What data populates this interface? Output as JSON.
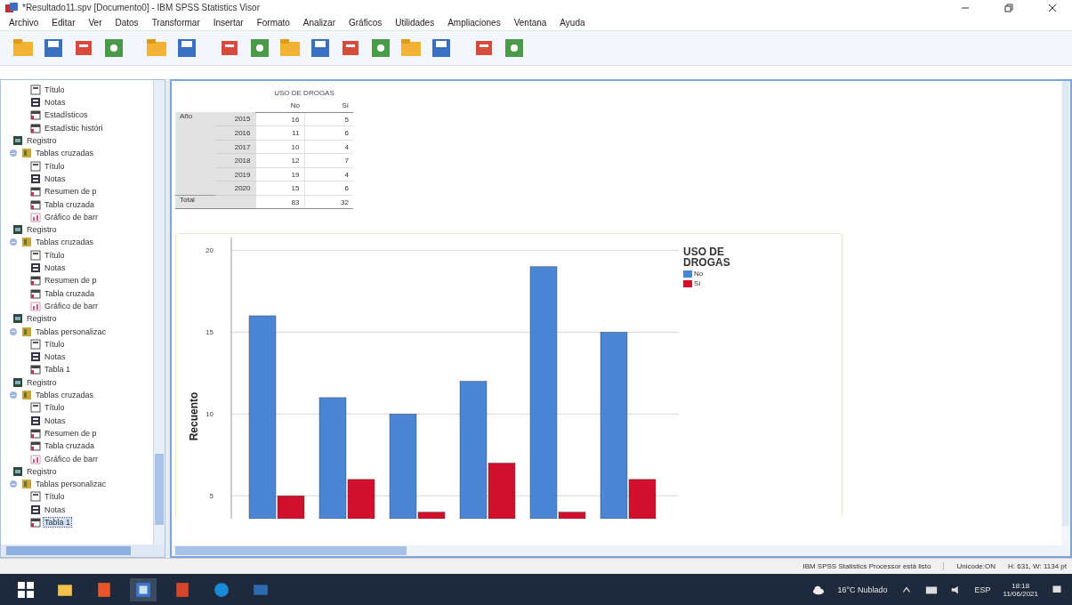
{
  "window": {
    "title": "*Resultado11.spv [Documento0] - IBM SPSS Statistics Visor"
  },
  "menu": [
    "Archivo",
    "Editar",
    "Ver",
    "Datos",
    "Transformar",
    "Insertar",
    "Formato",
    "Analizar",
    "Gráficos",
    "Utilidades",
    "Ampliaciones",
    "Ventana",
    "Ayuda"
  ],
  "outline": {
    "continued": [
      {
        "label": "Título",
        "kind": "title",
        "selected": false
      },
      {
        "label": "Notas",
        "kind": "notes",
        "selected": false
      },
      {
        "label": "Estadísticos",
        "kind": "table",
        "selected": false
      },
      {
        "label": "Estadístic históri",
        "kind": "table",
        "selected": false
      }
    ],
    "items": [
      {
        "label": "Registro",
        "kind": "log",
        "selected": false
      },
      {
        "label": "Tablas cruzadas",
        "kind": "folder",
        "expanded": true,
        "selected": false,
        "children": [
          {
            "label": "Título",
            "kind": "title",
            "selected": false
          },
          {
            "label": "Notas",
            "kind": "notes",
            "selected": false
          },
          {
            "label": "Resumen de p",
            "kind": "table",
            "selected": false
          },
          {
            "label": "Tabla cruzada",
            "kind": "table",
            "selected": false
          },
          {
            "label": "Gráfico de barr",
            "kind": "chart",
            "selected": false
          }
        ]
      },
      {
        "label": "Registro",
        "kind": "log",
        "selected": false
      },
      {
        "label": "Tablas cruzadas",
        "kind": "folder",
        "expanded": true,
        "selected": false,
        "children": [
          {
            "label": "Título",
            "kind": "title",
            "selected": false
          },
          {
            "label": "Notas",
            "kind": "notes",
            "selected": false
          },
          {
            "label": "Resumen de p",
            "kind": "table",
            "selected": false
          },
          {
            "label": "Tabla cruzada",
            "kind": "table",
            "selected": false
          },
          {
            "label": "Gráfico de barr",
            "kind": "chart",
            "selected": false
          }
        ]
      },
      {
        "label": "Registro",
        "kind": "log",
        "selected": false
      },
      {
        "label": "Tablas personalizac",
        "kind": "folder",
        "expanded": true,
        "selected": false,
        "children": [
          {
            "label": "Título",
            "kind": "title",
            "selected": false
          },
          {
            "label": "Notas",
            "kind": "notes",
            "selected": false
          },
          {
            "label": "Tabla 1",
            "kind": "table",
            "selected": false
          }
        ]
      },
      {
        "label": "Registro",
        "kind": "log",
        "selected": false
      },
      {
        "label": "Tablas cruzadas",
        "kind": "folder",
        "expanded": true,
        "selected": false,
        "children": [
          {
            "label": "Título",
            "kind": "title",
            "selected": false
          },
          {
            "label": "Notas",
            "kind": "notes",
            "selected": false
          },
          {
            "label": "Resumen de p",
            "kind": "table",
            "selected": false
          },
          {
            "label": "Tabla cruzada",
            "kind": "table",
            "selected": false
          },
          {
            "label": "Gráfico de barr",
            "kind": "chart",
            "selected": false
          }
        ]
      },
      {
        "label": "Registro",
        "kind": "log",
        "selected": false
      },
      {
        "label": "Tablas personalizac",
        "kind": "folder",
        "expanded": true,
        "selected": false,
        "children": [
          {
            "label": "Título",
            "kind": "title",
            "selected": false
          },
          {
            "label": "Notas",
            "kind": "notes",
            "selected": false
          },
          {
            "label": "Tabla 1",
            "kind": "table",
            "selected": true
          }
        ]
      }
    ]
  },
  "table": {
    "title": "USO DE DROGAS",
    "columns": [
      "No",
      "Sí"
    ],
    "row_group": "Año",
    "rows": [
      {
        "label": "2015",
        "values": [
          "16",
          "5"
        ]
      },
      {
        "label": "2016",
        "values": [
          "11",
          "6"
        ]
      },
      {
        "label": "2017",
        "values": [
          "10",
          "4"
        ]
      },
      {
        "label": "2018",
        "values": [
          "12",
          "7"
        ]
      },
      {
        "label": "2019",
        "values": [
          "19",
          "4"
        ]
      },
      {
        "label": "2020",
        "values": [
          "15",
          "6"
        ]
      }
    ],
    "total": {
      "label": "Total",
      "values": [
        "83",
        "32"
      ]
    }
  },
  "chart": {
    "legend_title": "USO DE DROGAS",
    "chart_data": {
      "type": "bar",
      "grid": true,
      "legend": true,
      "ylabel": "Recuento",
      "ylim": [
        3.6,
        21
      ],
      "yticks": [
        5,
        10,
        15,
        20
      ],
      "series": [
        {
          "name": "No",
          "color": "#4a86d4",
          "values": [
            16,
            11,
            10,
            12,
            19,
            15
          ]
        },
        {
          "name": "Sí",
          "color": "#d0102c",
          "values": [
            5,
            6,
            4,
            7,
            4,
            6
          ]
        }
      ]
    }
  },
  "status_bar": {
    "message": "IBM SPSS Statistics Processor está listo",
    "encoding": "Unicode:ON",
    "size": "H: 631, W: 1134 pt"
  },
  "taskbar": {
    "weather": "16°C Nublado",
    "language": "ESP",
    "time": "18:18",
    "date": "11/06/2021"
  }
}
